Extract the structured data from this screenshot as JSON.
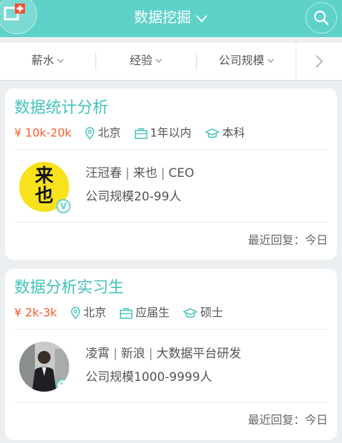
{
  "header": {
    "title": "数据挖掘",
    "corner_icon": "add-badge-icon",
    "search_icon": "search-icon"
  },
  "filters": [
    {
      "label": "薪水"
    },
    {
      "label": "经验"
    },
    {
      "label": "公司规模"
    }
  ],
  "jobs": [
    {
      "title": "数据统计分析",
      "salary": "10k-20k",
      "city": "北京",
      "experience": "1年以内",
      "education": "本科",
      "contact_name": "汪冠春",
      "contact_company": "来也",
      "contact_position": "CEO",
      "company_size": "公司规模20-99人",
      "reply": "最近回复：今日",
      "avatar_text": "来\n也",
      "verified": "V"
    },
    {
      "title": "数据分析实习生",
      "salary": "2k-3k",
      "city": "北京",
      "experience": "应届生",
      "education": "硕士",
      "contact_name": "凌霄",
      "contact_company": "新浪",
      "contact_position": "大数据平台研发",
      "company_size": "公司规模1000-9999人",
      "reply": "最近回复：今日",
      "verified": "V"
    }
  ],
  "colors": {
    "accent": "#5ed2c9",
    "title": "#41c3b8",
    "salary": "#ff5a2a",
    "logo_yellow": "#f7e21b"
  }
}
